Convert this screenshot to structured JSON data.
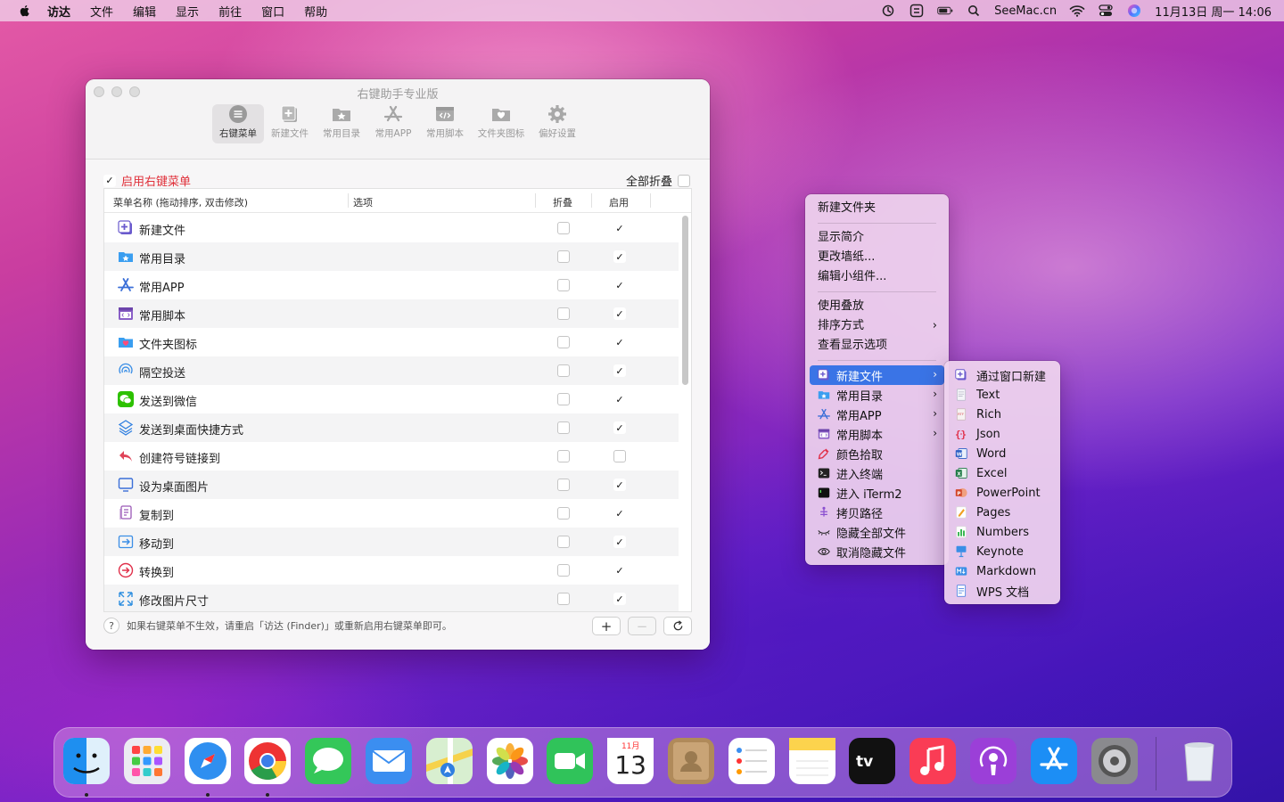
{
  "menubar": {
    "app": "访达",
    "items": [
      "文件",
      "编辑",
      "显示",
      "前往",
      "窗口",
      "帮助"
    ],
    "site": "SeeMac.cn",
    "datetime": "11月13日 周一  14:06"
  },
  "window": {
    "title": "右键助手专业版",
    "toolbar": [
      {
        "label": "右键菜单",
        "icon": "list-icon",
        "active": true
      },
      {
        "label": "新建文件",
        "icon": "new-file-icon"
      },
      {
        "label": "常用目录",
        "icon": "folder-star-icon"
      },
      {
        "label": "常用APP",
        "icon": "app-store-icon"
      },
      {
        "label": "常用脚本",
        "icon": "script-icon"
      },
      {
        "label": "文件夹图标",
        "icon": "folder-heart-icon"
      },
      {
        "label": "偏好设置",
        "icon": "gear-icon"
      }
    ],
    "enable_label": "启用右键菜单",
    "fold_all_label": "全部折叠",
    "columns": {
      "name": "菜单名称 (拖动排序, 双击修改)",
      "options": "选项",
      "fold": "折叠",
      "enable": "启用"
    },
    "rows": [
      {
        "label": "新建文件",
        "icon": "new-file-icon",
        "fold": false,
        "enabled": true
      },
      {
        "label": "常用目录",
        "icon": "folder-star-icon",
        "fold": false,
        "enabled": true
      },
      {
        "label": "常用APP",
        "icon": "app-store-icon",
        "fold": false,
        "enabled": true
      },
      {
        "label": "常用脚本",
        "icon": "script-icon",
        "fold": false,
        "enabled": true
      },
      {
        "label": "文件夹图标",
        "icon": "folder-heart-icon",
        "fold": false,
        "enabled": true
      },
      {
        "label": "隔空投送",
        "icon": "airdrop-icon",
        "fold": false,
        "enabled": true
      },
      {
        "label": "发送到微信",
        "icon": "wechat-icon",
        "fold": false,
        "enabled": true
      },
      {
        "label": "发送到桌面快捷方式",
        "icon": "shortcut-icon",
        "fold": false,
        "enabled": true
      },
      {
        "label": "创建符号链接到",
        "icon": "symlink-icon",
        "fold": false,
        "enabled": false
      },
      {
        "label": "设为桌面图片",
        "icon": "desktop-icon",
        "fold": false,
        "enabled": true
      },
      {
        "label": "复制到",
        "icon": "copy-icon",
        "fold": false,
        "enabled": true
      },
      {
        "label": "移动到",
        "icon": "move-icon",
        "fold": false,
        "enabled": true
      },
      {
        "label": "转换到",
        "icon": "convert-icon",
        "fold": false,
        "enabled": true
      },
      {
        "label": "修改图片尺寸",
        "icon": "resize-icon",
        "fold": false,
        "enabled": true
      }
    ],
    "help_text": "如果右键菜单不生效，请重启「访达 (Finder)」或重新启用右键菜单即可。"
  },
  "context_menu": {
    "group1": [
      "新建文件夹"
    ],
    "group2": [
      "显示简介",
      "更改墙纸...",
      "编辑小组件..."
    ],
    "group3": [
      "使用叠放",
      "排序方式",
      "查看显示选项"
    ],
    "group4": [
      {
        "label": "新建文件",
        "icon": "new-file-icon",
        "submenu": true,
        "highlighted": true
      },
      {
        "label": "常用目录",
        "icon": "folder-star-icon",
        "submenu": true
      },
      {
        "label": "常用APP",
        "icon": "app-store-icon",
        "submenu": true
      },
      {
        "label": "常用脚本",
        "icon": "script-icon",
        "submenu": true
      },
      {
        "label": "颜色拾取",
        "icon": "color-picker-icon"
      },
      {
        "label": "进入终端",
        "icon": "terminal-icon"
      },
      {
        "label": "进入 iTerm2",
        "icon": "iterm-icon"
      },
      {
        "label": "拷贝路径",
        "icon": "copy-path-icon"
      },
      {
        "label": "隐藏全部文件",
        "icon": "eye-closed-icon"
      },
      {
        "label": "取消隐藏文件",
        "icon": "eye-icon"
      }
    ]
  },
  "submenu": [
    {
      "label": "通过窗口新建",
      "icon": "new-file-icon",
      "color": "#5a4bd1"
    },
    {
      "label": "Text",
      "icon": "text-file-icon",
      "color": "#b9b9c8"
    },
    {
      "label": "Rich",
      "icon": "rtf-file-icon",
      "color": "#d8505a"
    },
    {
      "label": "Json",
      "icon": "json-icon",
      "color": "#e0304a"
    },
    {
      "label": "Word",
      "icon": "word-icon",
      "color": "#2b5fc4"
    },
    {
      "label": "Excel",
      "icon": "excel-icon",
      "color": "#1f7a46"
    },
    {
      "label": "PowerPoint",
      "icon": "powerpoint-icon",
      "color": "#d2472a"
    },
    {
      "label": "Pages",
      "icon": "pages-icon",
      "color": "#f0a020"
    },
    {
      "label": "Numbers",
      "icon": "numbers-icon",
      "color": "#2fb34a"
    },
    {
      "label": "Keynote",
      "icon": "keynote-icon",
      "color": "#3a8ee6"
    },
    {
      "label": "Markdown",
      "icon": "markdown-icon",
      "color": "#3a8ee6"
    },
    {
      "label": "WPS 文档",
      "icon": "wps-icon",
      "color": "#3a78e0"
    }
  ],
  "dock": {
    "calendar_month": "11月",
    "calendar_day": "13",
    "apps": [
      {
        "name": "finder-icon",
        "color": "#3fa3f5",
        "running": true
      },
      {
        "name": "launchpad-icon",
        "color": "#e9e9ef",
        "running": false
      },
      {
        "name": "safari-icon",
        "color": "#2f8ff0",
        "running": true
      },
      {
        "name": "chrome-icon",
        "color": "#ffffff",
        "running": true
      },
      {
        "name": "messages-icon",
        "color": "#34c759",
        "running": false
      },
      {
        "name": "mail-icon",
        "color": "#3b8ef0",
        "running": false
      },
      {
        "name": "maps-icon",
        "color": "#6cc46c",
        "running": false
      },
      {
        "name": "photos-icon",
        "color": "#ffffff",
        "running": false
      },
      {
        "name": "facetime-icon",
        "color": "#30c35a",
        "running": false
      },
      {
        "name": "calendar-icon",
        "color": "#ffffff",
        "running": false
      },
      {
        "name": "contacts-icon",
        "color": "#b08a5a",
        "running": false
      },
      {
        "name": "reminders-icon",
        "color": "#ffffff",
        "running": false
      },
      {
        "name": "notes-icon",
        "color": "#ffffff",
        "running": false
      },
      {
        "name": "appletv-icon",
        "color": "#111111",
        "running": false
      },
      {
        "name": "music-icon",
        "color": "#fa3c55",
        "running": false
      },
      {
        "name": "podcasts-icon",
        "color": "#9b3fd8",
        "running": false
      },
      {
        "name": "appstore-icon",
        "color": "#1c8ef5",
        "running": false
      },
      {
        "name": "system-preferences-icon",
        "color": "#8a8a8e",
        "running": false
      }
    ]
  },
  "colors": {
    "accent": "#3a74e6",
    "enable_red": "#e0303a"
  }
}
